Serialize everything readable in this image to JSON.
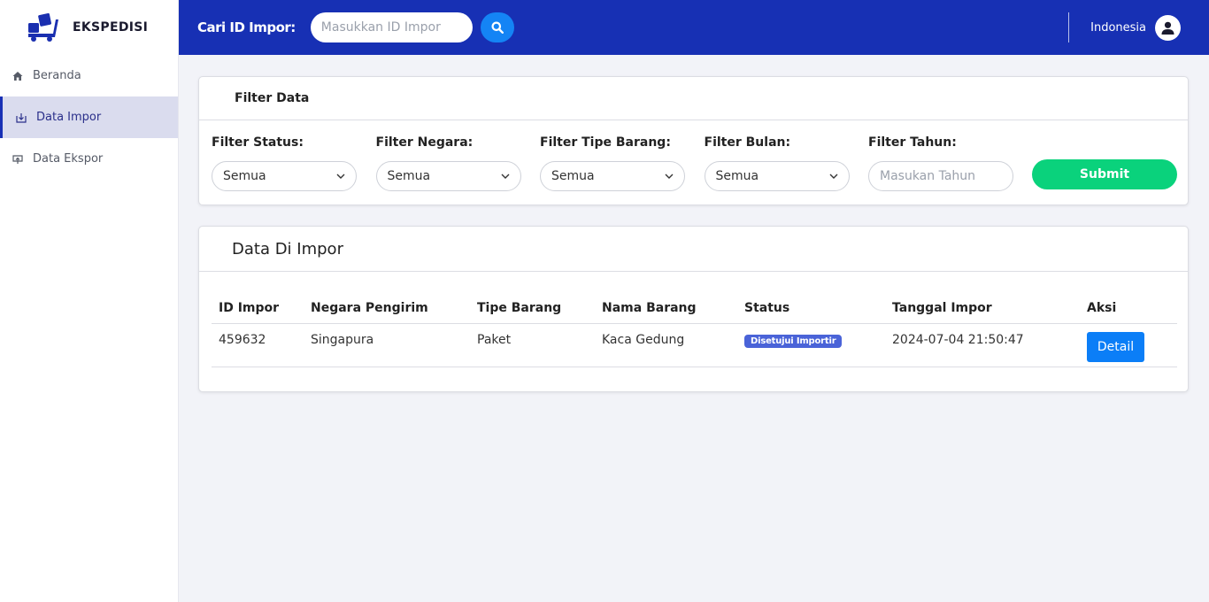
{
  "brand": {
    "name": "EKSPEDISI",
    "icon": "box-truck-logo-icon"
  },
  "sidebar": {
    "items": [
      {
        "label": "Beranda",
        "icon": "home-icon",
        "active": false
      },
      {
        "label": "Data Impor",
        "icon": "import-icon",
        "active": true
      },
      {
        "label": "Data Ekspor",
        "icon": "export-icon",
        "active": false
      }
    ]
  },
  "topbar": {
    "search_label": "Cari ID Impor:",
    "search_placeholder": "Masukkan ID Impor",
    "search_value": "",
    "language": "Indonesia"
  },
  "filter": {
    "title": "Filter Data",
    "status_label": "Filter Status:",
    "status_value": "Semua",
    "country_label": "Filter Negara:",
    "country_value": "Semua",
    "type_label": "Filter Tipe Barang:",
    "type_value": "Semua",
    "month_label": "Filter Bulan:",
    "month_value": "Semua",
    "year_label": "Filter Tahun:",
    "year_placeholder": "Masukan Tahun",
    "submit_label": "Submit"
  },
  "table": {
    "title": "Data Di Impor",
    "columns": [
      "ID Impor",
      "Negara Pengirim",
      "Tipe Barang",
      "Nama Barang",
      "Status",
      "Tanggal Impor",
      "Aksi"
    ],
    "rows": [
      {
        "id": "459632",
        "country": "Singapura",
        "type": "Paket",
        "name": "Kaca Gedung",
        "status": "Disetujui Importir",
        "date": "2024-07-04 21:50:47",
        "action": "Detail"
      }
    ]
  },
  "colors": {
    "topbar": "#1730b4",
    "search_button": "#1484f5",
    "submit": "#0ad27c",
    "badge": "#4a63d8",
    "detail_button": "#0b7ef7",
    "sidebar_active": "#dadcee"
  }
}
